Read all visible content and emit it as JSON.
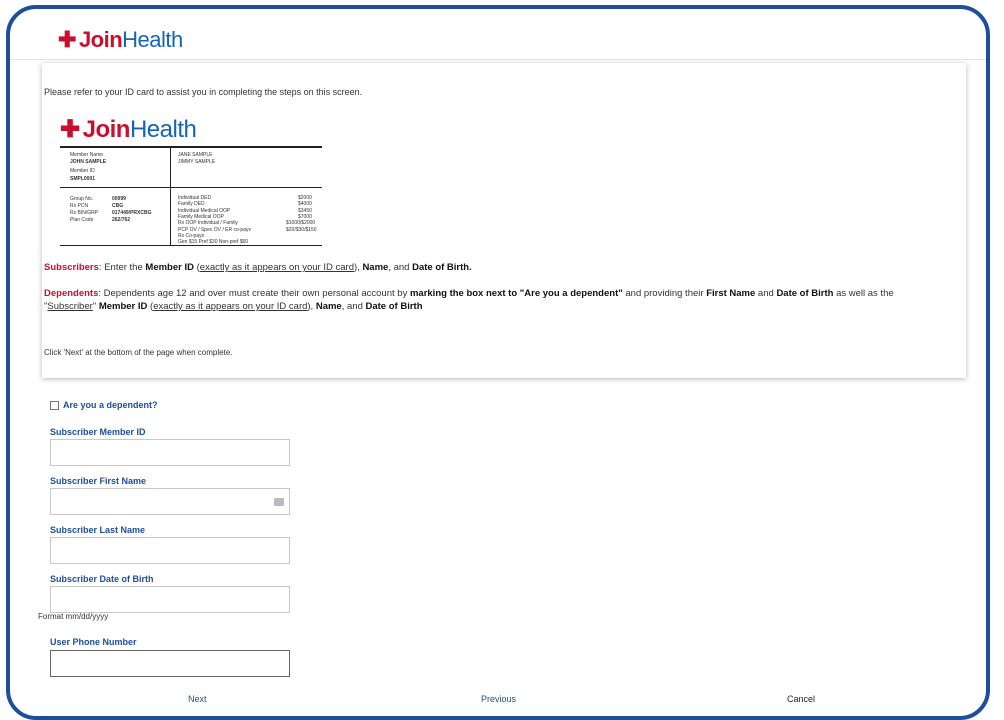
{
  "brand": {
    "logo_text_join": "Join",
    "logo_text_health": "Health",
    "logo_icon": "cross-logo-icon"
  },
  "intro": "Please refer to your ID card to assist you in completing the steps on this screen.",
  "card": {
    "member_name_label": "Member Name",
    "member_name": "JOHN SAMPLE",
    "member_id_label": "Member ID",
    "member_id": "SMPL0001",
    "dependents": [
      "JANE SAMPLE",
      "JIMMY SAMPLE"
    ],
    "group_label": "Group No.",
    "group_value": "00999",
    "rx_pcn_label": "Rx PCN",
    "rx_pcn_value": "CBG",
    "rx_bin_label": "Rx BIN/GRP",
    "rx_bin_value": "017449/PRXCBG",
    "plan_label": "Plan Code",
    "plan_value": "262/762",
    "benefits": [
      {
        "label": "Individual DED",
        "value": "$2000"
      },
      {
        "label": "Family DED",
        "value": "$4000"
      },
      {
        "label": "Individual Medical OOP",
        "value": "$3450"
      },
      {
        "label": "Family Medical OOP",
        "value": "$7000"
      },
      {
        "label": "Rx OOP Individual / Family",
        "value": "$1000/$2000"
      },
      {
        "label": "PCP OV / Spec OV / ER co-pays",
        "value": "$20/$30/$150"
      },
      {
        "label": "Rx Co-pays",
        "value": ""
      },
      {
        "label": "Gen $15  Pref $30  Non-pref $60",
        "value": ""
      }
    ]
  },
  "instructions": {
    "subscribers_label": "Subscribers",
    "subscribers_text1": ": Enter the ",
    "subscribers_bold1": "Member ID",
    "subscribers_text2": " (",
    "subscribers_underline": "exactly as it appears on your ID card",
    "subscribers_text3": "), ",
    "subscribers_bold2": "Name",
    "subscribers_text4": ", and ",
    "subscribers_bold3": "Date of Birth.",
    "dependents_label": "Dependents",
    "dependents_text1": ": Dependents age 12 and over must create their own personal account by ",
    "dependents_bold1": "marking the box next to \"Are you a dependent\"",
    "dependents_text2": " and providing their ",
    "dependents_bold2": "First Name",
    "dependents_text3": " and ",
    "dependents_bold3": "Date of Birth",
    "dependents_text4": " as well as the \"",
    "dependents_underline1": "Subscriber",
    "dependents_text5": "\" ",
    "dependents_bold4": "Member ID",
    "dependents_text6": " (",
    "dependents_underline2": "exactly as it appears on your ID card",
    "dependents_text7": "), ",
    "dependents_bold5": "Name",
    "dependents_text8": ", and ",
    "dependents_bold6": "Date of Birth",
    "next_note": "Click 'Next' at the bottom of the page when complete."
  },
  "form": {
    "dependent_checkbox_label": "Are you a dependent?",
    "dependent_checked": false,
    "member_id_label": "Subscriber Member ID",
    "member_id_value": "",
    "first_name_label": "Subscriber First Name",
    "first_name_value": "",
    "last_name_label": "Subscriber Last Name",
    "last_name_value": "",
    "dob_label": "Subscriber Date of Birth",
    "dob_value": "",
    "dob_hint": "Format mm/dd/yyyy",
    "phone_label": "User Phone Number",
    "phone_value": ""
  },
  "nav": {
    "next": "Next",
    "previous": "Previous",
    "cancel": "Cancel"
  },
  "colors": {
    "brand_blue": "#1d4f9c",
    "brand_red": "#c8102e",
    "logo_blue": "#1565b4"
  }
}
